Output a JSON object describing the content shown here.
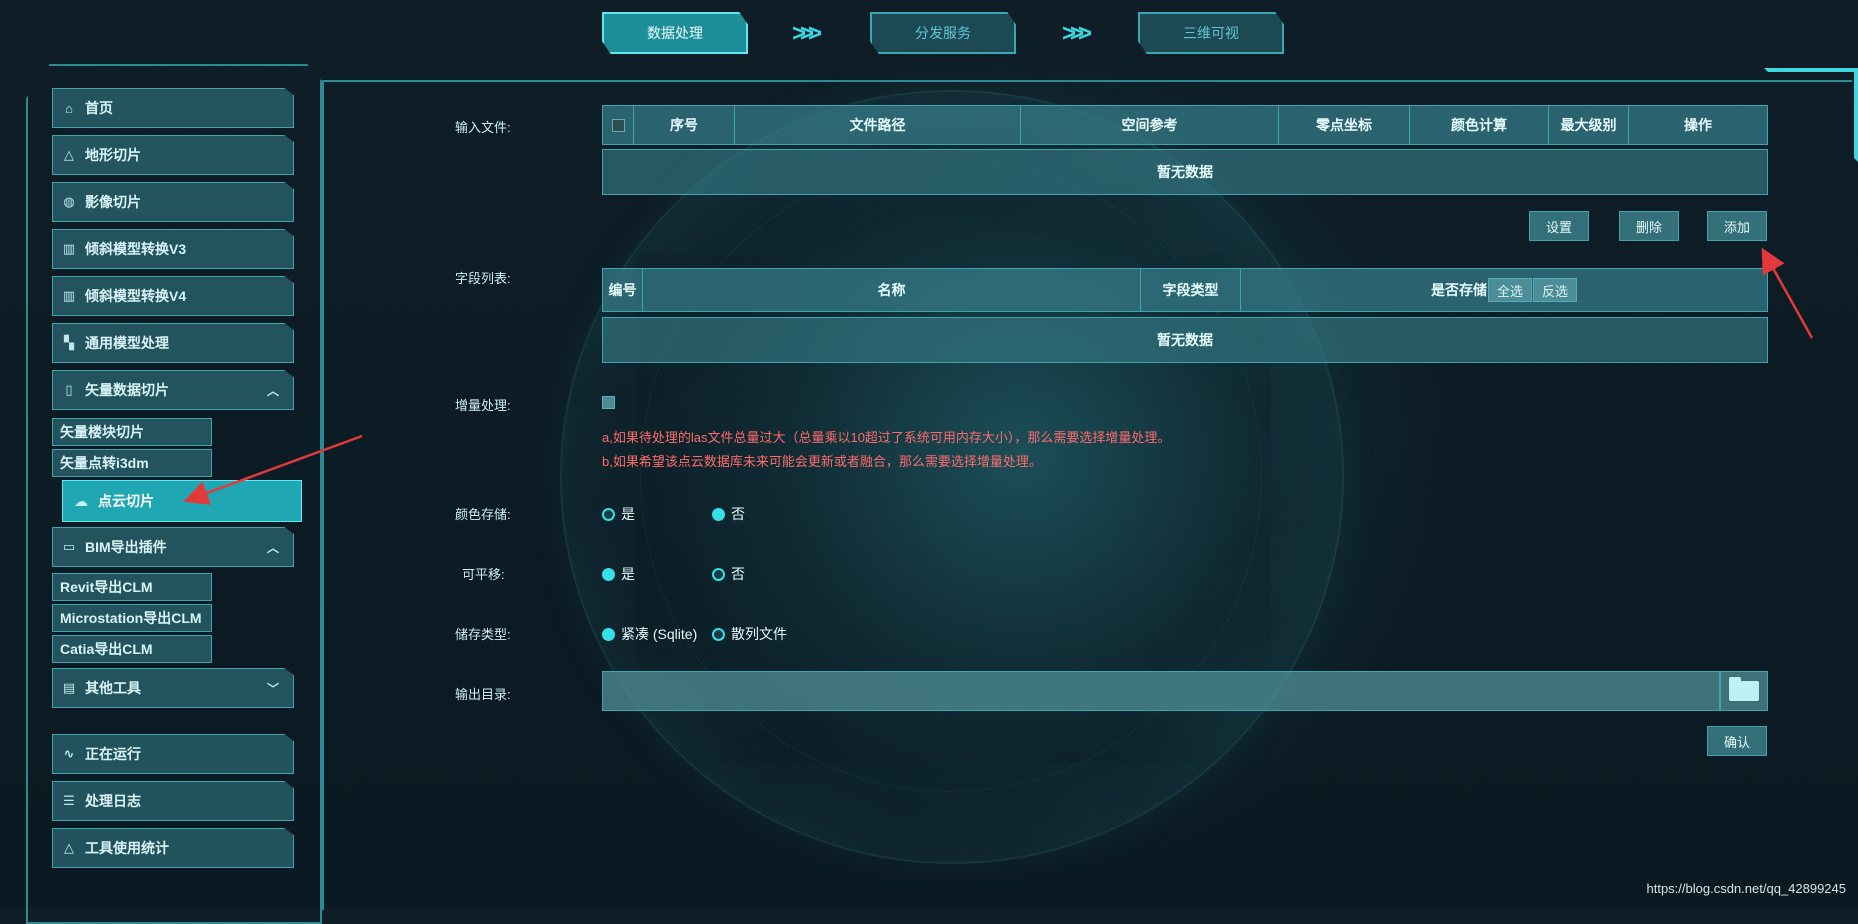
{
  "steps": [
    {
      "label": "数据处理",
      "active": true
    },
    {
      "label": "分发服务",
      "active": false
    },
    {
      "label": "三维可视",
      "active": false
    }
  ],
  "sidebar": {
    "items": [
      {
        "label": "首页",
        "icon": "home-icon"
      },
      {
        "label": "地形切片",
        "icon": "terrain-icon"
      },
      {
        "label": "影像切片",
        "icon": "globe-icon"
      },
      {
        "label": "倾斜模型转换V3",
        "icon": "building-icon"
      },
      {
        "label": "倾斜模型转换V4",
        "icon": "building-icon"
      },
      {
        "label": "通用模型处理",
        "icon": "blocks-icon"
      },
      {
        "label": "矢量数据切片",
        "icon": "vector-icon",
        "expanded": true
      },
      {
        "label": "BIM导出插件",
        "icon": "bim-icon",
        "expanded": true
      },
      {
        "label": "其他工具",
        "icon": "toolbox-icon",
        "expanded": false
      },
      {
        "label": "正在运行",
        "icon": "pulse-icon"
      },
      {
        "label": "处理日志",
        "icon": "log-icon"
      },
      {
        "label": "工具使用统计",
        "icon": "stats-icon"
      }
    ],
    "vector_sub": [
      "矢量楼块切片",
      "矢量点转i3dm"
    ],
    "active_sub": "点云切片",
    "bim_sub": [
      "Revit导出CLM",
      "Microstation导出CLM",
      "Catia导出CLM"
    ]
  },
  "form": {
    "input_files_label": "输入文件:",
    "input_table_headers": [
      "序号",
      "文件路径",
      "空间参考",
      "零点坐标",
      "颜色计算",
      "最大级别",
      "操作"
    ],
    "empty_text": "暂无数据",
    "buttons": {
      "settings": "设置",
      "delete": "删除",
      "add": "添加",
      "confirm": "确认"
    },
    "field_list_label": "字段列表:",
    "field_table_headers": [
      "编号",
      "名称",
      "字段类型",
      "是否存储"
    ],
    "select_all": "全选",
    "invert": "反选",
    "incremental_label": "增量处理:",
    "note_a": "a,如果待处理的las文件总量过大（总量乘以10超过了系统可用内存大小），那么需要选择增量处理。",
    "note_b": "b,如果希望该点云数据库未来可能会更新或者融合，那么需要选择增量处理。",
    "color_storage_label": "颜色存储:",
    "color_storage": {
      "options": [
        "是",
        "否"
      ],
      "selected": "否"
    },
    "translatable_label": "可平移:",
    "translatable": {
      "options": [
        "是",
        "否"
      ],
      "selected": "否"
    },
    "storage_type_label": "储存类型:",
    "storage_type": {
      "options": [
        "紧凑 (Sqlite)",
        "散列文件"
      ],
      "selected": "散列文件"
    },
    "output_dir_label": "输出目录:",
    "output_dir_value": ""
  },
  "watermark": "https://blog.csdn.net/qq_42899245",
  "colors": {
    "accent": "#35e0ea",
    "panel": "#38828e",
    "note": "#ff6b6b"
  }
}
